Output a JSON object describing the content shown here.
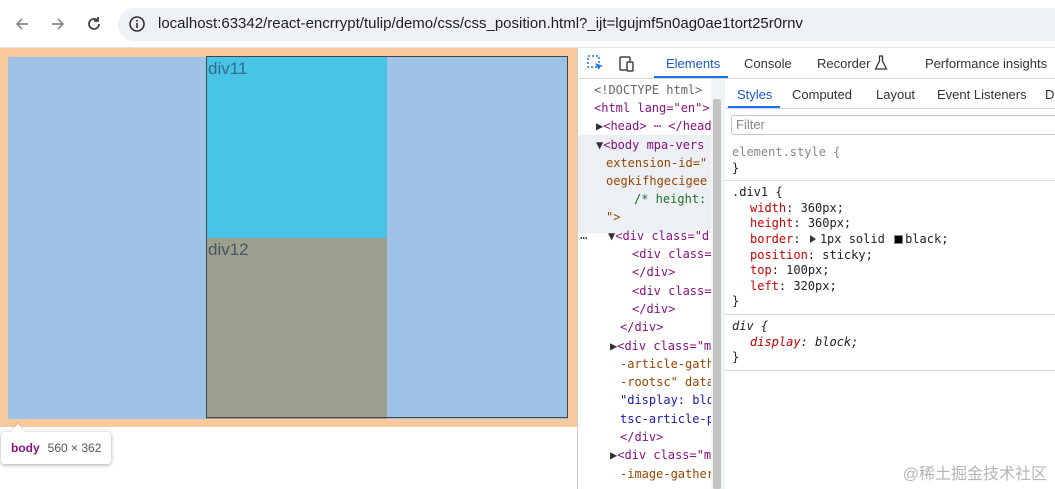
{
  "browser": {
    "url": "localhost:63342/react-encrrypt/tulip/demo/css/css_position.html?_ijt=lgujmf5n0ag0ae1tort25r0rnv",
    "icons": [
      "back-icon",
      "forward-icon",
      "reload-icon",
      "info-icon"
    ]
  },
  "page": {
    "div11_label": "div11",
    "div12_label": "div12",
    "tooltip": {
      "tag": "body",
      "dimensions": "560 × 362"
    },
    "colors": {
      "margin": "#f7c99c",
      "content": "#9fc3e7",
      "div11": "#47c4e6",
      "div12": "#9da08f"
    }
  },
  "devtools": {
    "tabs": [
      "Elements",
      "Console",
      "Recorder",
      "Performance insights"
    ],
    "active_tab": "Elements",
    "dom_lines": [
      "<!DOCTYPE html>",
      "<html lang=\"en\">",
      "<head> ⋯ </head>",
      "<body mpa-vers",
      "extension-id=\"",
      "oegkifhgecigee",
      "/* height:",
      "\">",
      "<div class=\"d",
      "<div class=",
      "</div>",
      "<div class=",
      "</div>",
      "</div>",
      "<div class=\"m",
      "-article-gath",
      "-rootsc\" data",
      "\"display: blo",
      "tsc-article-p",
      "</div>",
      "<div class=\"m",
      "-image-gather"
    ],
    "styles_tabs": [
      "Styles",
      "Computed",
      "Layout",
      "Event Listeners",
      "DOM"
    ],
    "active_styles_tab": "Styles",
    "filter_placeholder": "Filter",
    "element_style": {
      "selector": "element.style {",
      "close": "}"
    },
    "rule_div1": {
      "selector": ".div1 {",
      "props": [
        {
          "name": "width",
          "value": "360px;"
        },
        {
          "name": "height",
          "value": "360px;"
        },
        {
          "name": "border",
          "value": "1px solid",
          "extra": "black;"
        },
        {
          "name": "position",
          "value": "sticky;"
        },
        {
          "name": "top",
          "value": "100px;"
        },
        {
          "name": "left",
          "value": "320px;"
        }
      ],
      "close": "}"
    },
    "rule_div": {
      "selector": "div {",
      "props": [
        {
          "name": "display",
          "value": "block;"
        }
      ],
      "close": "}"
    }
  },
  "watermark": "@稀土掘金技术社区"
}
